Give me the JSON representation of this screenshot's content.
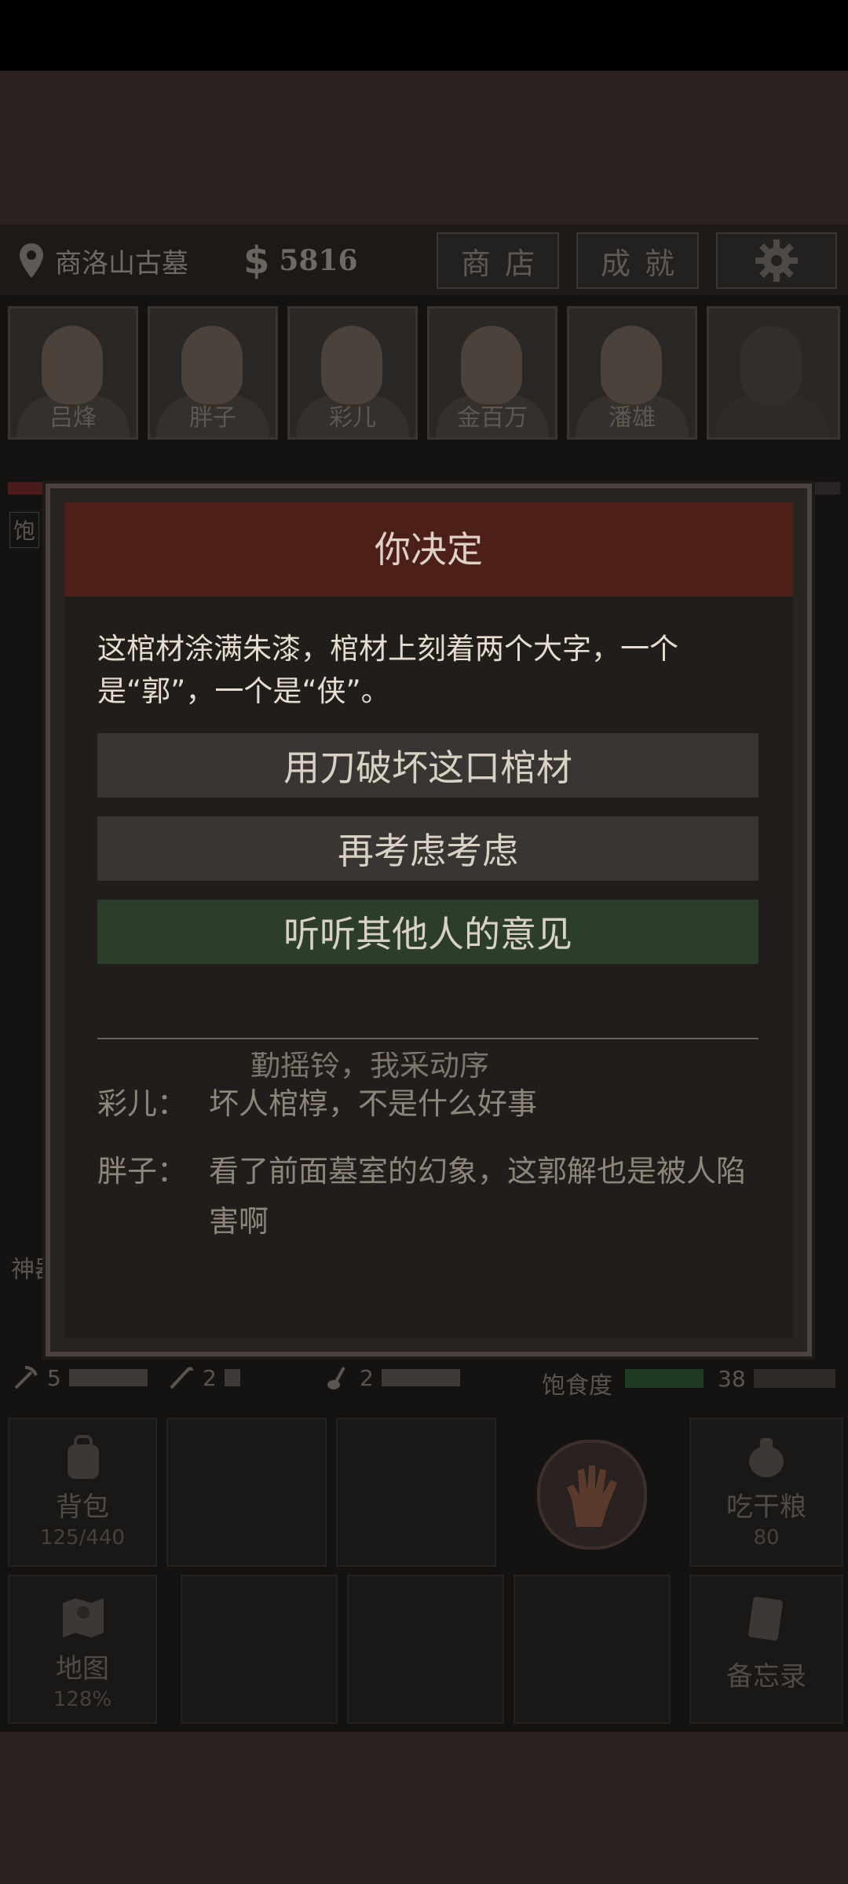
{
  "topbar": {
    "location": "商洛山古墓",
    "money": "5816",
    "shop_label": "商店",
    "achievement_label": "成就"
  },
  "portraits": [
    "吕烽",
    "胖子",
    "彩儿",
    "金百万",
    "潘雄",
    ""
  ],
  "side_tags": {
    "hunger_short": "饱",
    "item_tag": "神器"
  },
  "stats": {
    "tool1_count": "5",
    "tool2_count": "2",
    "tool3_count": "2",
    "hunger_label": "饱食度",
    "hunger_value": "38"
  },
  "bottom": {
    "backpack_label": "背包",
    "backpack_capacity": "125/440",
    "eat_label": "吃干粮",
    "eat_count": "80",
    "map_label": "地图",
    "map_percent": "128%",
    "memo_label": "备忘录"
  },
  "dialog": {
    "title": "你决定",
    "narration": "这棺材涂满朱漆，棺材上刻着两个大字，一个是“郭”，一个是“侠”。",
    "choices": [
      "用刀破坏这口棺材",
      "再考虑考虑",
      "听听其他人的意见"
    ],
    "log_cut": "勤摇铃，我采动序",
    "log": [
      {
        "speaker": "彩儿：",
        "text": "坏人棺椁，不是什么好事"
      },
      {
        "speaker": "胖子：",
        "text": "看了前面墓室的幻象，这郭解也是被人陷害啊"
      }
    ]
  },
  "colors": {
    "dialog_header": "#4c1f18",
    "choice_default": "#393532",
    "choice_highlight": "#2c3e2b"
  },
  "icons": [
    "location-pin-icon",
    "dollar-icon",
    "gear-icon",
    "pickaxe-icon",
    "crowbar-icon",
    "shovel-icon",
    "backpack-icon",
    "hand-icon",
    "map-icon",
    "memo-icon"
  ]
}
